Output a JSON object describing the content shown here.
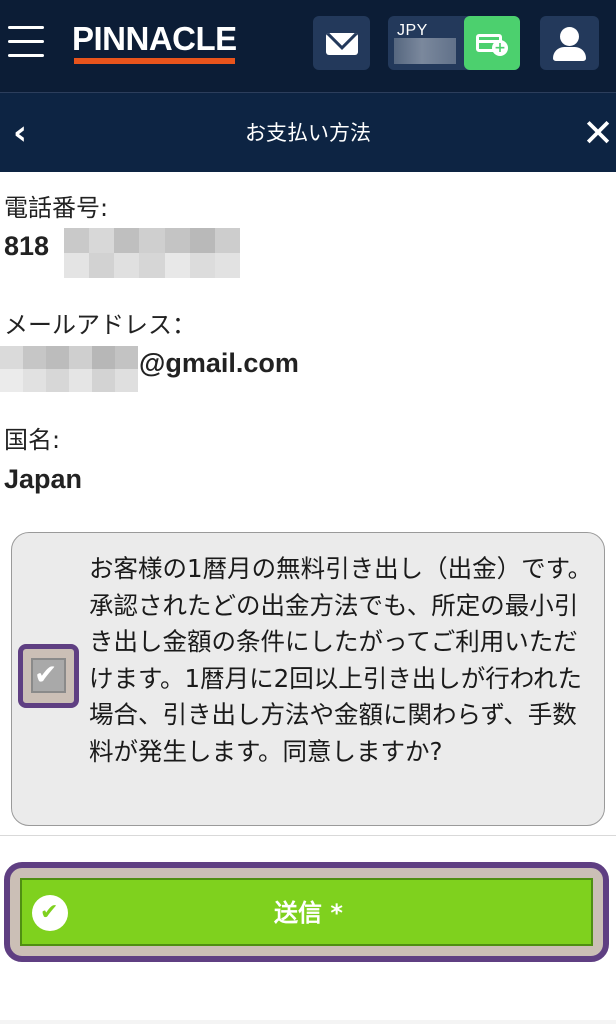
{
  "header": {
    "logo_text": "PINNACLE",
    "currency": "JPY",
    "icons": {
      "menu": "hamburger-icon",
      "mail": "envelope-icon",
      "deposit": "card-plus-icon",
      "account": "user-icon"
    },
    "colors": {
      "background": "#0c1d36",
      "button": "#23395b",
      "deposit": "#4cd06e",
      "logo_accent": "#e8541c"
    }
  },
  "subheader": {
    "title": "お支払い方法",
    "back_icon": "chevron-left-icon",
    "close_icon": "close-icon"
  },
  "fields": {
    "phone": {
      "label": "電話番号:",
      "value_visible": "818"
    },
    "email": {
      "label": "メールアドレス：",
      "value_visible": "@gmail.com"
    },
    "country": {
      "label": "国名:",
      "value": "Japan"
    }
  },
  "consent": {
    "checked": true,
    "text": "お客様の1暦月の無料引き出し（出金）です。承認されたどの出金方法でも、所定の最小引き出し金額の条件にしたがってご利用いただけます。1暦月に2回以上引き出しが行われた場合、引き出し方法や金額に関わらず、手数料が発生します。同意しますか?"
  },
  "submit": {
    "label": "送信 *",
    "icon": "check-circle-icon",
    "color": "#7fd11e"
  },
  "highlight_color": "#5f3f82"
}
